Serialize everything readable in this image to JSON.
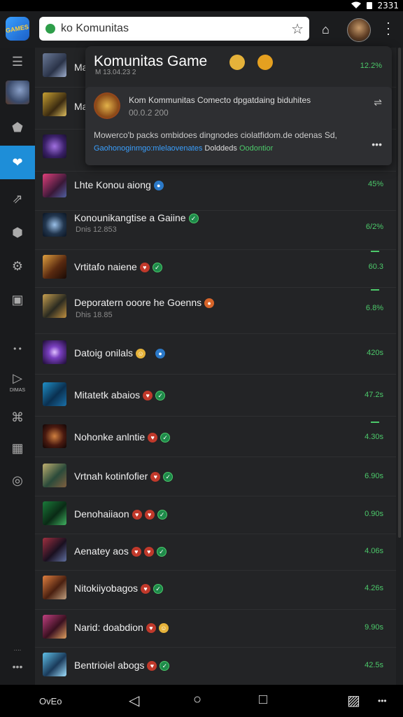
{
  "status": {
    "time": "2331"
  },
  "topbar": {
    "app_logo_text": "GAMES",
    "url_text": "ko Komunitas"
  },
  "rail": {
    "items": [
      {
        "name": "menu-icon",
        "glyph": "☰"
      },
      {
        "name": "game-thumb"
      },
      {
        "name": "gamepad-icon",
        "glyph": "⬟"
      },
      {
        "name": "heart-icon",
        "glyph": "❤"
      },
      {
        "name": "share-icon",
        "glyph": "⇗"
      },
      {
        "name": "shield-icon",
        "glyph": "⬢"
      },
      {
        "name": "settings-icon",
        "glyph": "⚙"
      },
      {
        "name": "image-icon",
        "glyph": "▣"
      },
      {
        "name": "dots-icon",
        "glyph": "⋯"
      },
      {
        "name": "play-icon",
        "glyph": "▷"
      },
      {
        "name": "link-icon",
        "glyph": "⌘"
      },
      {
        "name": "photo-icon",
        "glyph": "▦"
      },
      {
        "name": "tag-icon",
        "glyph": "◎"
      },
      {
        "name": "more-icon",
        "glyph": "•••"
      }
    ],
    "play_label": "DIMAS"
  },
  "popover": {
    "title": "Komunitas Game",
    "subtitle": "M 13.04.23 2",
    "pct": "12.2%",
    "card": {
      "title": "Kom Kommunitas Comecto dpgatdaing biduhites",
      "date": "00.0.2 200",
      "body": "Mowerco'b packs ombidoes dingnodes ciolatfidom.de odenas Sd,",
      "link1": "Gaohonoginmgo:mlelaovenates",
      "link2": "Dolddeds",
      "link3": "Oodontior"
    }
  },
  "rows": [
    {
      "title": "Ma",
      "sub": "",
      "pct": "",
      "badges": []
    },
    {
      "title": "Ma",
      "sub": "",
      "pct": "",
      "badges": []
    },
    {
      "title": "",
      "sub": "",
      "pct": "",
      "badges": []
    },
    {
      "title": "Lhte Konou aiong",
      "sub": "",
      "pct": "45%",
      "badges": [
        "blue"
      ]
    },
    {
      "title": "Konounikangtise a Gaiine",
      "sub": "Dnis 12.853",
      "pct": "6/2%",
      "badges": [
        "green"
      ]
    },
    {
      "title": "Vrtitafo naiene",
      "sub": "",
      "pct": "60.3",
      "badges": [
        "red",
        "green"
      ]
    },
    {
      "title": "Deporatern ooore he Goenns",
      "sub": "Dhis 18.85",
      "pct": "6.8%",
      "badges": [
        "orange"
      ]
    },
    {
      "title": "Datoig onilals",
      "sub": "",
      "pct": "420s",
      "badges": [
        "yellow",
        "blue"
      ]
    },
    {
      "title": "Mitatetk abaios",
      "sub": "",
      "pct": "47.2s",
      "badges": [
        "red",
        "green"
      ]
    },
    {
      "title": "Nohonke anlntie",
      "sub": "",
      "pct": "4.30s",
      "badges": [
        "red",
        "green"
      ]
    },
    {
      "title": "Vrtnah kotinfofier",
      "sub": "",
      "pct": "6.90s",
      "badges": [
        "red",
        "green"
      ]
    },
    {
      "title": "Denohaiiaon",
      "sub": "",
      "pct": "0.90s",
      "badges": [
        "red",
        "red",
        "green"
      ]
    },
    {
      "title": "Aenatey aos",
      "sub": "",
      "pct": "4.06s",
      "badges": [
        "red",
        "red",
        "green"
      ]
    },
    {
      "title": "Nitokiiyobagos",
      "sub": "",
      "pct": "4.26s",
      "badges": [
        "red",
        "green"
      ]
    },
    {
      "title": "Narid: doabdion",
      "sub": "",
      "pct": "9.90s",
      "badges": [
        "red",
        "yellow"
      ]
    },
    {
      "title": "Bentrioiel abogs",
      "sub": "",
      "pct": "42.5s",
      "badges": [
        "red",
        "green"
      ]
    }
  ],
  "navbar": {
    "left_label": "OvEo"
  }
}
